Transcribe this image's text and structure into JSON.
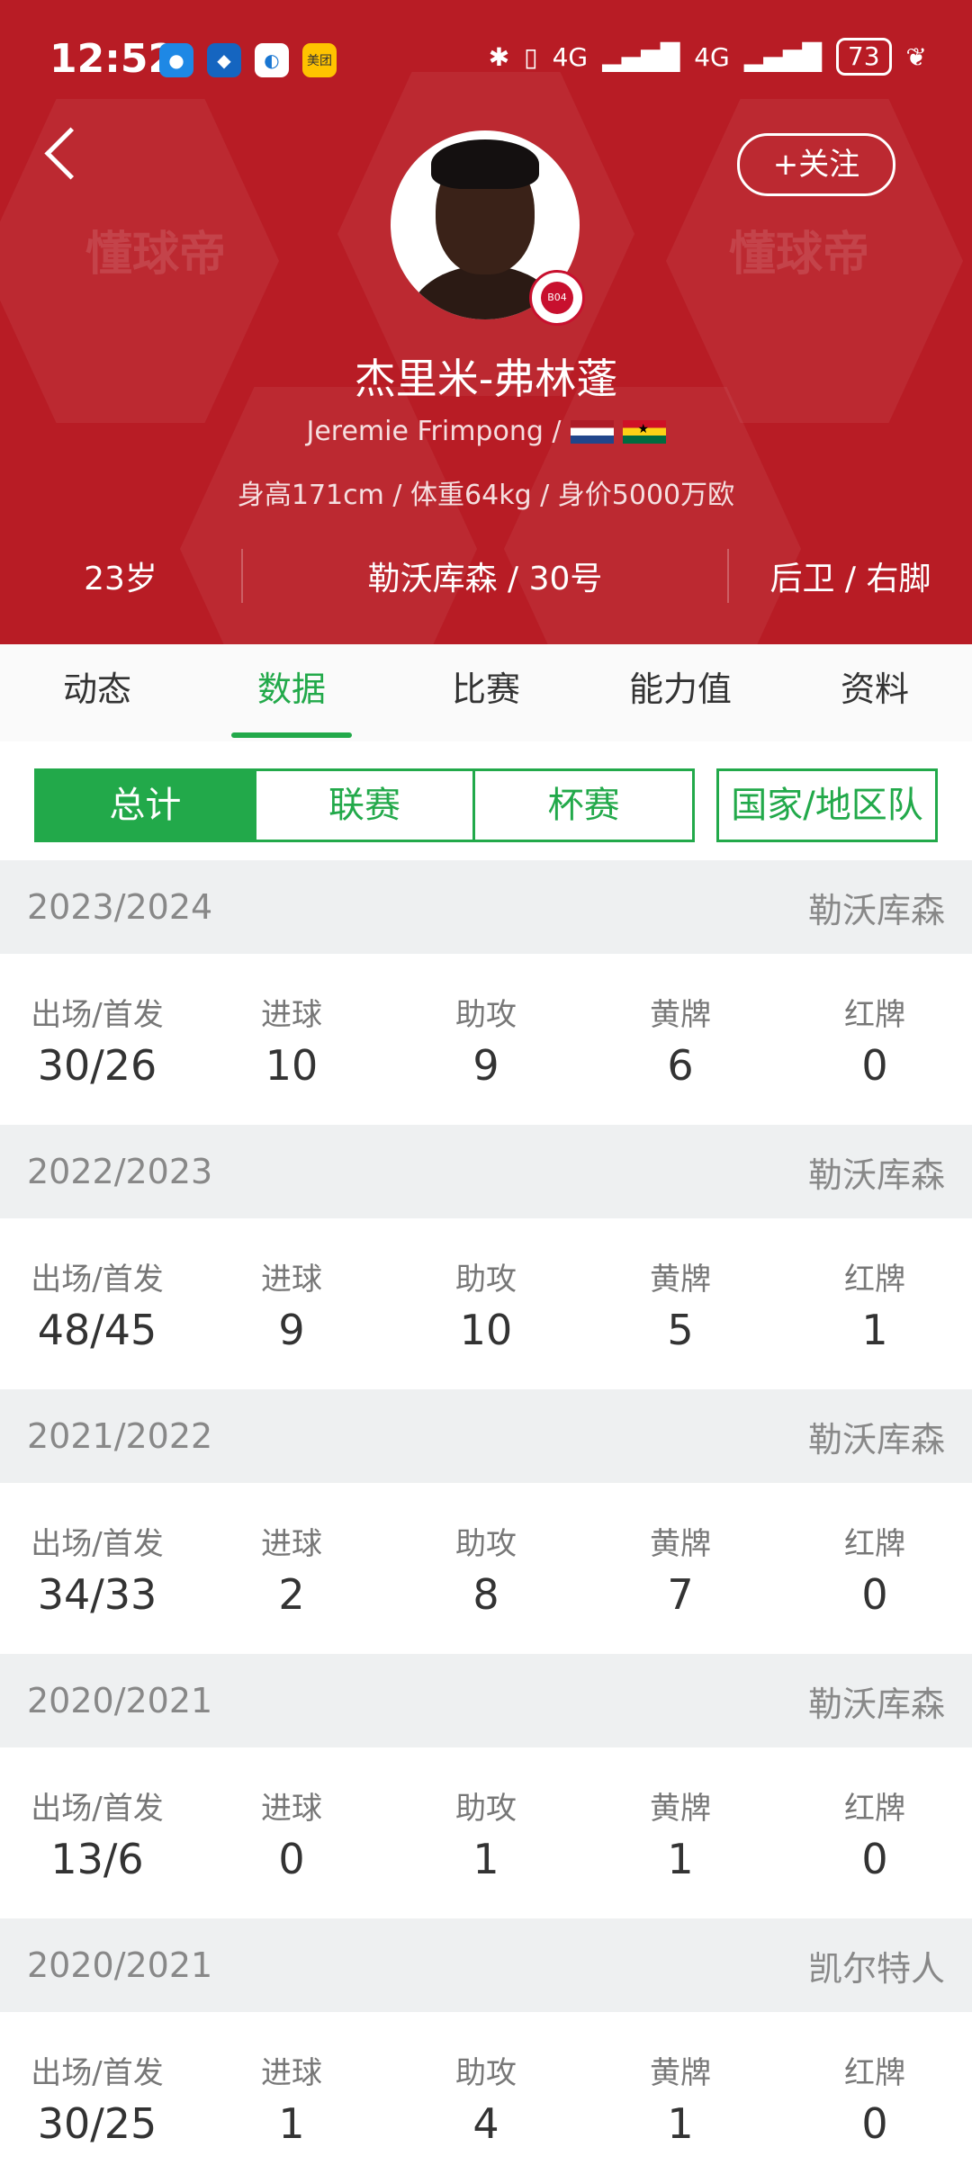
{
  "status_bar": {
    "time": "12:52",
    "app_icons": [
      "message-icon",
      "shield-app-icon",
      "browser-icon",
      "meituan-icon"
    ],
    "meituan_label": "美团",
    "network": "4G",
    "battery": "73"
  },
  "header": {
    "follow_label": "+关注",
    "watermark": "懂球帝",
    "player_name": "杰里米-弗林蓬",
    "english_name": "Jeremie Frimpong /",
    "nationalities": [
      "Netherlands",
      "Ghana"
    ],
    "bio": "身高171cm / 体重64kg / 身价5000万欧",
    "age": "23岁",
    "club_number": "勒沃库森 / 30号",
    "position_foot": "后卫 / 右脚",
    "theme_color": "#b81c25"
  },
  "tabs": [
    {
      "label": "动态"
    },
    {
      "label": "数据"
    },
    {
      "label": "比赛"
    },
    {
      "label": "能力值"
    },
    {
      "label": "资料"
    }
  ],
  "active_tab": "数据",
  "filters": {
    "segments": [
      "总计",
      "联赛",
      "杯赛"
    ],
    "active": "总计",
    "national": "国家/地区队",
    "accent_color": "#22a94a"
  },
  "stat_labels": [
    "出场/首发",
    "进球",
    "助攻",
    "黄牌",
    "红牌"
  ],
  "seasons": [
    {
      "season": "2023/2024",
      "club": "勒沃库森",
      "values": [
        "30/26",
        "10",
        "9",
        "6",
        "0"
      ]
    },
    {
      "season": "2022/2023",
      "club": "勒沃库森",
      "values": [
        "48/45",
        "9",
        "10",
        "5",
        "1"
      ]
    },
    {
      "season": "2021/2022",
      "club": "勒沃库森",
      "values": [
        "34/33",
        "2",
        "8",
        "7",
        "0"
      ]
    },
    {
      "season": "2020/2021",
      "club": "勒沃库森",
      "values": [
        "13/6",
        "0",
        "1",
        "1",
        "0"
      ]
    },
    {
      "season": "2020/2021",
      "club": "凯尔特人",
      "values": [
        "30/25",
        "1",
        "4",
        "1",
        "0"
      ]
    }
  ]
}
